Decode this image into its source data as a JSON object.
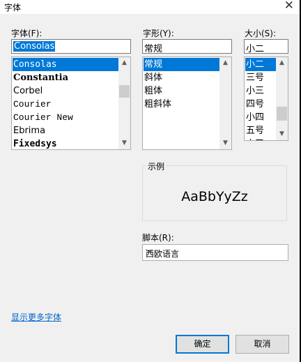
{
  "dialog": {
    "title": "字体"
  },
  "font": {
    "label": "字体(F):",
    "value": "Consolas",
    "items": [
      "Consolas",
      "Constantia",
      "Corbel",
      "Courier",
      "Courier New",
      "Ebrima",
      "Fixedsys"
    ],
    "selected_index": 0
  },
  "style": {
    "label": "字形(Y):",
    "value": "常规",
    "items": [
      "常规",
      "斜体",
      "粗体",
      "粗斜体"
    ],
    "selected_index": 0
  },
  "size": {
    "label": "大小(S):",
    "value": "小二",
    "items": [
      "小二",
      "三号",
      "小三",
      "四号",
      "小四",
      "五号",
      "小五"
    ],
    "selected_index": 0
  },
  "sample": {
    "label": "示例",
    "text": "AaBbYyZz"
  },
  "script": {
    "label": "脚本(R):",
    "value": "西欧语言"
  },
  "more_fonts_link": "显示更多字体",
  "buttons": {
    "ok": "确定",
    "cancel": "取消"
  },
  "colors": {
    "accent": "#0078d7",
    "link": "#0066cc",
    "dialog_bg": "#f0f0f0"
  },
  "icons": {
    "close": "close-icon",
    "scroll_up": "chevron-up-icon",
    "scroll_down": "chevron-down-icon",
    "dropdown": "chevron-down-icon"
  }
}
